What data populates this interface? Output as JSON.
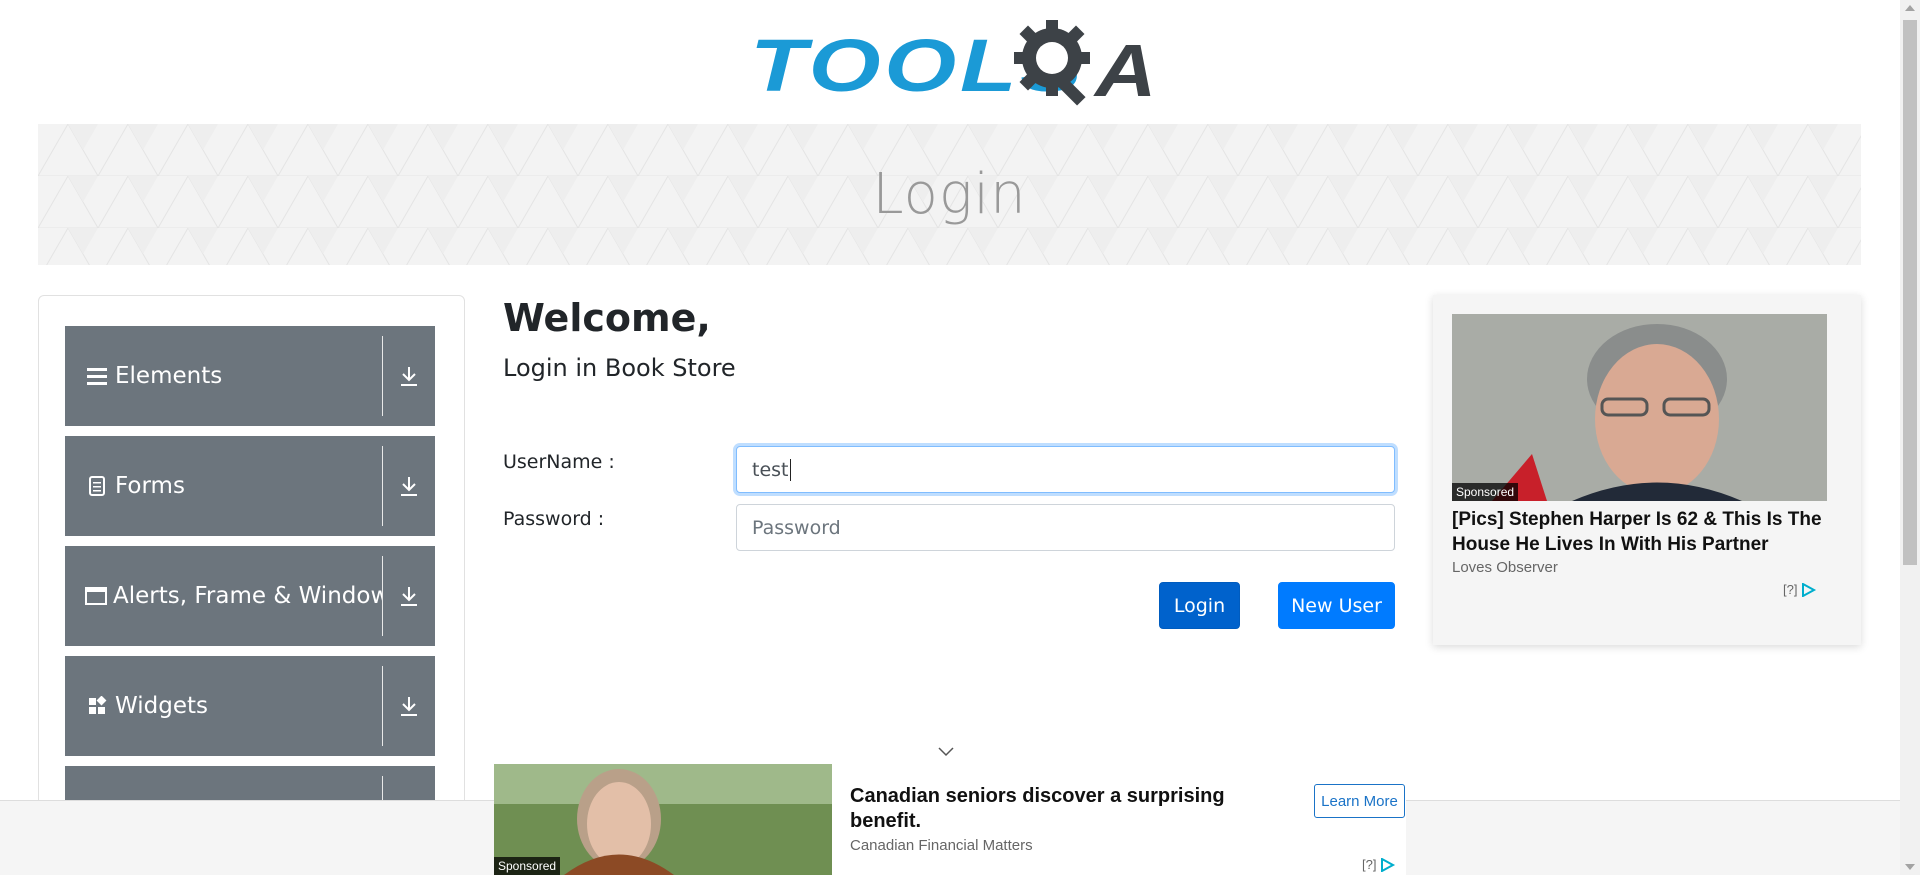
{
  "header": {
    "logo_text": "TOOLS",
    "logo_suffix": "A",
    "logo_alt": "TOOLSQA"
  },
  "banner": {
    "title": "Login"
  },
  "sidebar": {
    "groups": [
      {
        "label": "Elements",
        "icon": "hamburger-icon"
      },
      {
        "label": "Forms",
        "icon": "document-icon"
      },
      {
        "label": "Alerts, Frame & Windows",
        "icon": "window-icon"
      },
      {
        "label": "Widgets",
        "icon": "widgets-icon"
      },
      {
        "label": "",
        "icon": ""
      }
    ],
    "expand_icon": "download-arrow-icon"
  },
  "main": {
    "welcome": "Welcome,",
    "subtitle": "Login in Book Store",
    "username_label": "UserName :",
    "username_value": "test",
    "password_label": "Password :",
    "password_placeholder": "Password",
    "login_button": "Login",
    "new_user_button": "New User"
  },
  "right_ad": {
    "sponsored": "Sponsored",
    "title": "[Pics] Stephen Harper Is 62 & This Is The House He Lives In With His Partner",
    "source": "Loves Observer",
    "adchoice": "[?]"
  },
  "bottom_ad": {
    "sponsored": "Sponsored",
    "title": "Canadian seniors discover a surprising benefit.",
    "source": "Canadian Financial Matters",
    "cta": "Learn More",
    "adchoice": "[?]"
  },
  "colors": {
    "logo_blue": "#1b9ad6",
    "logo_dark": "#3d4247",
    "sidebar_group": "#6c757d",
    "primary_button": "#007bff",
    "primary_button_active": "#0062cc"
  }
}
